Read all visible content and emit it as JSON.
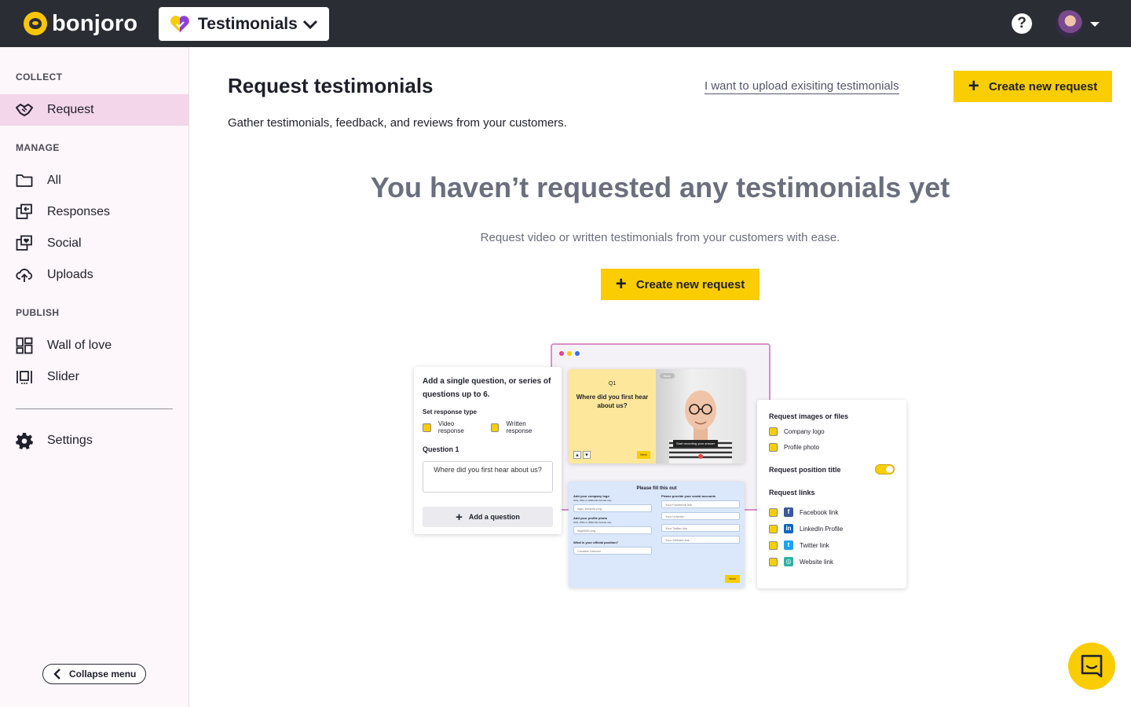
{
  "topbar": {
    "brand": "bonjoro",
    "product": "Testimonials",
    "help": "?"
  },
  "sidebar": {
    "sections": {
      "collect": "COLLECT",
      "manage": "MANAGE",
      "publish": "PUBLISH"
    },
    "items": [
      {
        "label": "Request",
        "icon": "handshake-icon",
        "active": true
      },
      {
        "label": "All",
        "icon": "folder-icon"
      },
      {
        "label": "Responses",
        "icon": "responses-icon"
      },
      {
        "label": "Social",
        "icon": "social-icon"
      },
      {
        "label": "Uploads",
        "icon": "upload-cloud-icon"
      },
      {
        "label": "Wall of love",
        "icon": "wall-grid-icon"
      },
      {
        "label": "Slider",
        "icon": "slider-icon"
      },
      {
        "label": "Settings",
        "icon": "gear-icon"
      }
    ],
    "collapse_label": "Collapse menu"
  },
  "main": {
    "title": "Request testimonials",
    "subtitle": "Gather testimonials, feedback, and reviews from your customers.",
    "upload_link": "I want to upload exisiting testimonials",
    "create_button": "Create new request",
    "empty_title": "You haven’t requested any testimonials yet",
    "empty_subtitle": "Request video or written testimonials from your customers with ease.",
    "empty_button": "Create new request"
  },
  "illustration": {
    "left_card": {
      "heading": "Add a single question, or series of questions up to 6.",
      "response_type_label": "Set response type",
      "option_video": "Video response",
      "option_written": "Written response",
      "question_label": "Question 1",
      "question_text": "Where did you first hear about us?",
      "add_question": "Add a question"
    },
    "video_card": {
      "q_num": "Q1",
      "question": "Where did you first hear about us?",
      "next": "Next",
      "back": "Back",
      "record_tip": "Start recording your answer"
    },
    "form_card": {
      "title": "Please fill this out",
      "logo_label": "Add your company logo",
      "logo_hint": "SVG, PNG or JPEG file formats only",
      "logo_file": "logo_bonjoro.png",
      "photo_label": "Add your profile photo",
      "photo_hint": "SVG, PNG or JPEG file formats only",
      "photo_file": "img0000.png",
      "position_label": "What is your official position?",
      "position_value": "Creative Director",
      "social_label": "Please provide your social accounts",
      "fb_placeholder": "Your Facebook link",
      "li_placeholder": "Your LinkedIn",
      "tw_placeholder": "Your Twitter link",
      "web_placeholder": "Your Website link",
      "next": "Next"
    },
    "right_card": {
      "images_title": "Request images or files",
      "company_logo": "Company logo",
      "profile_photo": "Profile photo",
      "position_title": "Request position title",
      "links_title": "Request links",
      "facebook": "Facebook link",
      "linkedin": "LinkedIn Profile",
      "twitter": "Twitter link",
      "website": "Website link"
    }
  },
  "colors": {
    "topbar": "#2b2d35",
    "accent_yellow": "#f9cd00",
    "sidebar_bg": "#fdf6fb",
    "active_item": "#f3d6ea"
  }
}
